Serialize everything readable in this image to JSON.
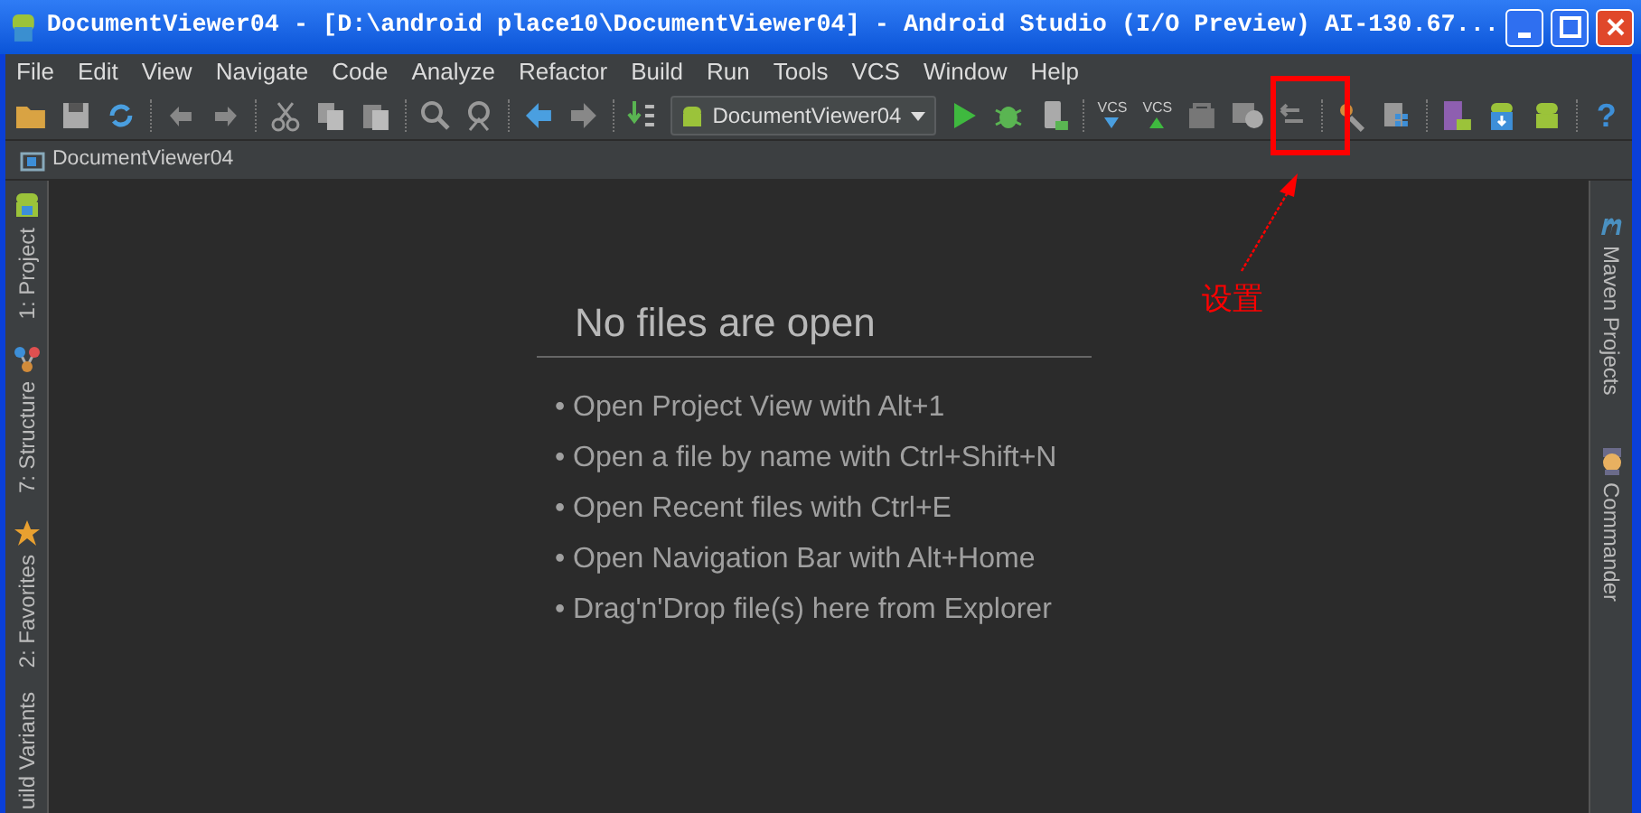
{
  "window": {
    "title": "DocumentViewer04 - [D:\\android place10\\DocumentViewer04] - Android Studio (I/O Preview) AI-130.67..."
  },
  "menu": [
    "File",
    "Edit",
    "View",
    "Navigate",
    "Code",
    "Analyze",
    "Refactor",
    "Build",
    "Run",
    "Tools",
    "VCS",
    "Window",
    "Help"
  ],
  "toolbar": {
    "run_configuration": "DocumentViewer04",
    "vcs_labels": [
      "VCS",
      "VCS"
    ],
    "help_label": "?"
  },
  "breadcrumb": [
    "DocumentViewer04"
  ],
  "left_tool_windows": [
    {
      "label": "1: Project",
      "kind": "project"
    },
    {
      "label": "7: Structure",
      "kind": "structure"
    },
    {
      "label": "2: Favorites",
      "kind": "favorites"
    },
    {
      "label": "uild Variants",
      "kind": "none"
    }
  ],
  "right_tool_windows": [
    {
      "label": "Maven Projects",
      "kind": "maven"
    },
    {
      "label": "Commander",
      "kind": "commander"
    }
  ],
  "editor": {
    "title": "No files are open",
    "hints": [
      "• Open Project View with Alt+1",
      "• Open a file by name with Ctrl+Shift+N",
      "• Open Recent files with Ctrl+E",
      "• Open Navigation Bar with Alt+Home",
      "• Drag'n'Drop file(s) here from Explorer"
    ]
  },
  "annotation": {
    "label": "设置"
  }
}
